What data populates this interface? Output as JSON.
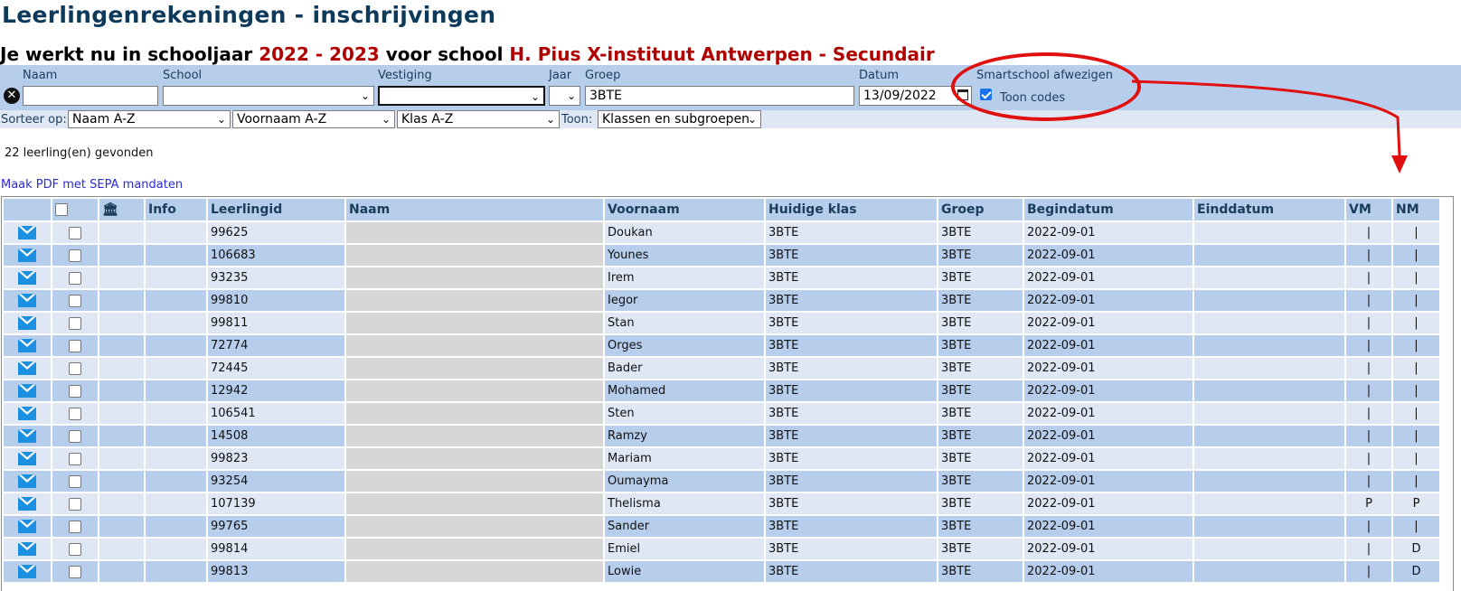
{
  "page": {
    "title": "Leerlingenrekeningen - inschrijvingen",
    "subtitle_prefix": "Je werkt nu in schooljaar",
    "school_year": "2022 - 2023",
    "subtitle_mid": "voor school",
    "school_name": "H. Pius X-instituut Antwerpen - Secundair"
  },
  "filters": {
    "naam_label": "Naam",
    "naam_value": "",
    "school_label": "School",
    "school_value": "",
    "vestiging_label": "Vestiging",
    "vestiging_value": "",
    "jaar_label": "Jaar",
    "jaar_value": "",
    "groep_label": "Groep",
    "groep_value": "3BTE",
    "datum_label": "Datum",
    "datum_value": "13/09/2022",
    "smartschool_label": "Smartschool afwezigen",
    "toon_codes_label": "Toon codes",
    "toon_codes_checked": true
  },
  "sort": {
    "label": "Sorteer op:",
    "option1": "Naam A-Z",
    "option2": "Voornaam A-Z",
    "option3": "Klas A-Z",
    "toon_label": "Toon:",
    "toon_value": "Klassen en subgroepen"
  },
  "result_count": "22 leerling(en) gevonden",
  "pdf_link": "Maak PDF met SEPA mandaten",
  "table": {
    "headers": {
      "info": "Info",
      "leerlingid": "Leerlingid",
      "naam": "Naam",
      "voornaam": "Voornaam",
      "klas": "Huidige klas",
      "groep": "Groep",
      "begindatum": "Begindatum",
      "einddatum": "Einddatum",
      "vm": "VM",
      "nm": "NM"
    },
    "rows": [
      {
        "id": "99625",
        "voornaam": "Doukan",
        "klas": "3BTE",
        "groep": "3BTE",
        "begin": "2022-09-01",
        "eind": "",
        "vm": "|",
        "nm": "|"
      },
      {
        "id": "106683",
        "voornaam": "Younes",
        "klas": "3BTE",
        "groep": "3BTE",
        "begin": "2022-09-01",
        "eind": "",
        "vm": "|",
        "nm": "|"
      },
      {
        "id": "93235",
        "voornaam": "Irem",
        "klas": "3BTE",
        "groep": "3BTE",
        "begin": "2022-09-01",
        "eind": "",
        "vm": "|",
        "nm": "|"
      },
      {
        "id": "99810",
        "voornaam": "Iegor",
        "klas": "3BTE",
        "groep": "3BTE",
        "begin": "2022-09-01",
        "eind": "",
        "vm": "|",
        "nm": "|"
      },
      {
        "id": "99811",
        "voornaam": "Stan",
        "klas": "3BTE",
        "groep": "3BTE",
        "begin": "2022-09-01",
        "eind": "",
        "vm": "|",
        "nm": "|"
      },
      {
        "id": "72774",
        "voornaam": "Orges",
        "klas": "3BTE",
        "groep": "3BTE",
        "begin": "2022-09-01",
        "eind": "",
        "vm": "|",
        "nm": "|"
      },
      {
        "id": "72445",
        "voornaam": "Bader",
        "klas": "3BTE",
        "groep": "3BTE",
        "begin": "2022-09-01",
        "eind": "",
        "vm": "|",
        "nm": "|"
      },
      {
        "id": "12942",
        "voornaam": "Mohamed",
        "klas": "3BTE",
        "groep": "3BTE",
        "begin": "2022-09-01",
        "eind": "",
        "vm": "|",
        "nm": "|"
      },
      {
        "id": "106541",
        "voornaam": "Sten",
        "klas": "3BTE",
        "groep": "3BTE",
        "begin": "2022-09-01",
        "eind": "",
        "vm": "|",
        "nm": "|"
      },
      {
        "id": "14508",
        "voornaam": "Ramzy",
        "klas": "3BTE",
        "groep": "3BTE",
        "begin": "2022-09-01",
        "eind": "",
        "vm": "|",
        "nm": "|"
      },
      {
        "id": "99823",
        "voornaam": "Mariam",
        "klas": "3BTE",
        "groep": "3BTE",
        "begin": "2022-09-01",
        "eind": "",
        "vm": "|",
        "nm": "|"
      },
      {
        "id": "93254",
        "voornaam": "Oumayma",
        "klas": "3BTE",
        "groep": "3BTE",
        "begin": "2022-09-01",
        "eind": "",
        "vm": "|",
        "nm": "|"
      },
      {
        "id": "107139",
        "voornaam": "Thelisma",
        "klas": "3BTE",
        "groep": "3BTE",
        "begin": "2022-09-01",
        "eind": "",
        "vm": "P",
        "nm": "P"
      },
      {
        "id": "99765",
        "voornaam": "Sander",
        "klas": "3BTE",
        "groep": "3BTE",
        "begin": "2022-09-01",
        "eind": "",
        "vm": "|",
        "nm": "|"
      },
      {
        "id": "99814",
        "voornaam": "Emiel",
        "klas": "3BTE",
        "groep": "3BTE",
        "begin": "2022-09-01",
        "eind": "",
        "vm": "|",
        "nm": "D"
      },
      {
        "id": "99813",
        "voornaam": "Lowie",
        "klas": "3BTE",
        "groep": "3BTE",
        "begin": "2022-09-01",
        "eind": "",
        "vm": "|",
        "nm": "D"
      }
    ]
  },
  "colors": {
    "title": "#0d3a5a",
    "accent_red": "#b00000",
    "header_bg": "#b7cdec",
    "row_light": "#dfe7f5",
    "annotation": "#e01010"
  }
}
